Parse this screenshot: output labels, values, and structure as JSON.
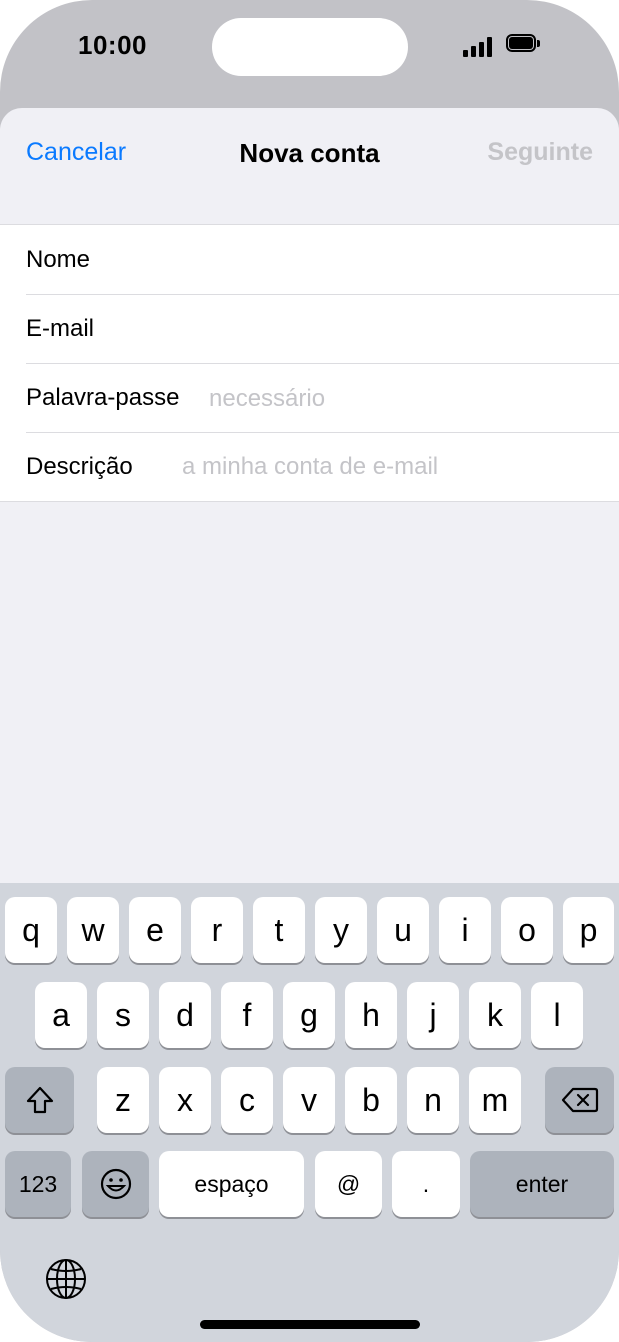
{
  "status_bar": {
    "time": "10:00"
  },
  "nav": {
    "cancel": "Cancelar",
    "title": "Nova conta",
    "next": "Seguinte"
  },
  "form": {
    "name_label": "Nome",
    "email_label": "E-mail",
    "password_label": "Palavra-passe",
    "password_placeholder": "necessário",
    "description_label": "Descrição",
    "description_placeholder": "a minha conta de e-mail"
  },
  "keyboard": {
    "row1": [
      "q",
      "w",
      "e",
      "r",
      "t",
      "y",
      "u",
      "i",
      "o",
      "p"
    ],
    "row2": [
      "a",
      "s",
      "d",
      "f",
      "g",
      "h",
      "j",
      "k",
      "l"
    ],
    "row3": [
      "z",
      "x",
      "c",
      "v",
      "b",
      "n",
      "m"
    ],
    "numbers_key": "123",
    "space_key": "espaço",
    "at_key": "@",
    "period_key": ".",
    "enter_key": "enter"
  },
  "colors": {
    "accent": "#0a7aff",
    "disabled": "#c4c4c8"
  }
}
